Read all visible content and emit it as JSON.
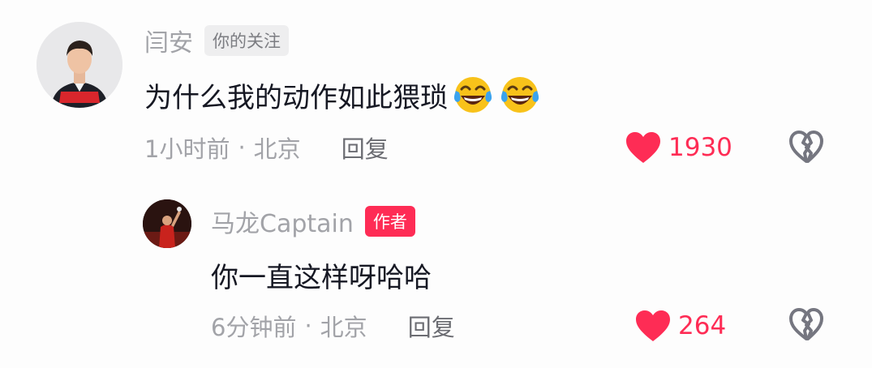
{
  "comments": [
    {
      "username": "闫安",
      "badge": "你的关注",
      "text": "为什么我的动作如此猥琐",
      "emojis": [
        "tears-of-joy-emoji",
        "tears-of-joy-emoji"
      ],
      "time": "1小时前",
      "location": "北京",
      "separator": "·",
      "reply_label": "回复",
      "likes": "1930"
    },
    {
      "username": "马龙Captain",
      "badge": "作者",
      "text": "你一直这样呀哈哈",
      "time": "6分钟前",
      "location": "北京",
      "separator": "·",
      "reply_label": "回复",
      "likes": "264"
    }
  ],
  "colors": {
    "accent": "#fe2c55",
    "muted_text": "#a2a3a8",
    "body_text": "#161823",
    "background": "#fdfdfd"
  },
  "icons": {
    "like": "heart-icon",
    "dislike": "broken-heart-icon"
  }
}
